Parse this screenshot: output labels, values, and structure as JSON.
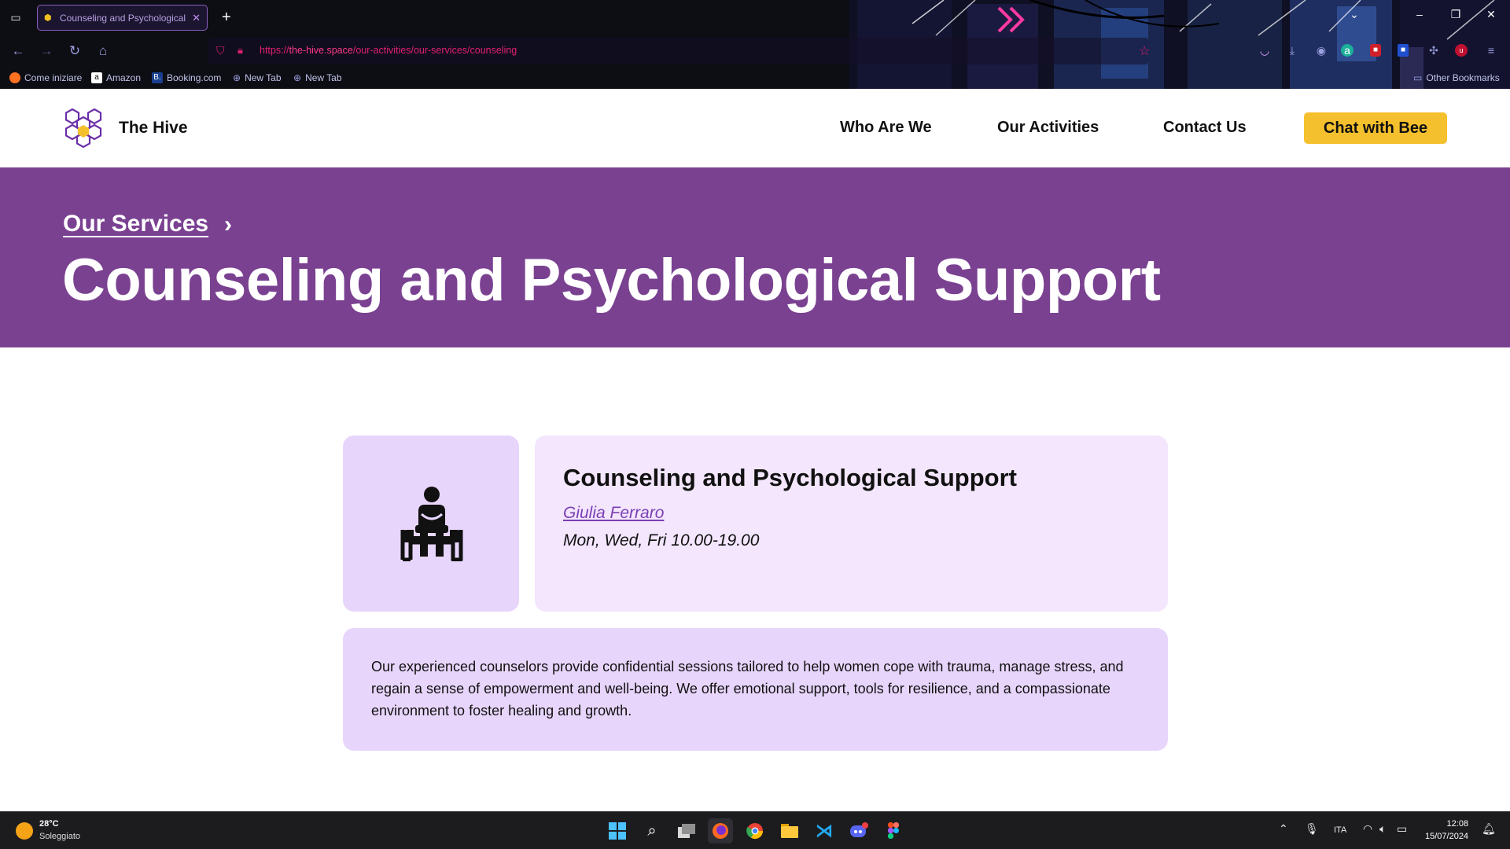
{
  "browser": {
    "tab_title": "Counseling and Psychological",
    "url_prefix": "https://",
    "url_domain": "the-hive.space",
    "url_path": "/our-activities/our-services/counseling",
    "bookmarks": [
      "Come iniziare",
      "Amazon",
      "Booking.com",
      "New Tab",
      "New Tab"
    ],
    "other_bookmarks": "Other Bookmarks"
  },
  "site": {
    "brand": "The Hive",
    "nav": [
      "Who Are We",
      "Our Activities",
      "Contact Us"
    ],
    "cta": "Chat with Bee",
    "breadcrumb": "Our Services",
    "page_title": "Counseling and Psychological Support"
  },
  "service": {
    "title": "Counseling and Psychological Support",
    "counselor": "Giulia Ferraro",
    "hours": "Mon, Wed, Fri 10.00-19.00",
    "description": "Our experienced counselors provide confidential sessions tailored to help women cope with trauma, manage stress, and regain a sense of empowerment and well-being. We offer emotional support, tools for resilience, and a compassionate environment to foster healing and growth."
  },
  "taskbar": {
    "temperature": "28°C",
    "weather": "Soleggiato",
    "language": "ITA",
    "time": "12:08",
    "date": "15/07/2024"
  },
  "colors": {
    "hero": "#7a4191",
    "accent": "#f5c02d",
    "card_light": "#f3e6fd",
    "card": "#e8d5fb"
  }
}
